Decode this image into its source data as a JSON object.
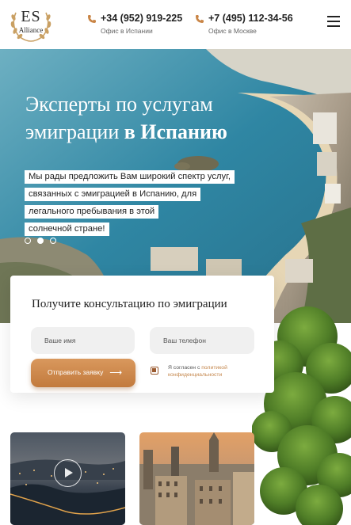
{
  "header": {
    "logo": {
      "main": "ES",
      "sub": "Alliance"
    },
    "phones": [
      {
        "number": "+34 (952) 919-225",
        "caption": "Офис в Испании"
      },
      {
        "number": "+7 (495) 112-34-56",
        "caption": "Офис в Москве"
      }
    ],
    "menu_icon": "hamburger-icon"
  },
  "hero": {
    "title_line1": "Эксперты по услугам",
    "title_line2_prefix": "эмиграции ",
    "title_line2_bold": "в Испанию",
    "text_lines": [
      "Мы рады предложить Вам широкий спектр услуг,",
      "связанных с эмиграцией в Испанию, для",
      "легального пребывания в этой",
      "солнечной стране!"
    ],
    "slides": {
      "count": 3,
      "active_index": 1
    }
  },
  "form": {
    "title": "Получите консультацию по эмиграции",
    "name_placeholder": "Ваше имя",
    "phone_placeholder": "Ваш телефон",
    "submit_label": "Отправить заявку",
    "submit_icon": "arrow-right-icon",
    "consent_prefix": "Я согласен с ",
    "consent_link": "политикой конфиденциальности",
    "consent_checked": true
  },
  "tiles": [
    {
      "name": "video-tile",
      "icon": "play-icon"
    },
    {
      "name": "city-tile"
    }
  ],
  "colors": {
    "accent": "#c98546",
    "accent_link": "#c4864b",
    "text": "#222222"
  }
}
